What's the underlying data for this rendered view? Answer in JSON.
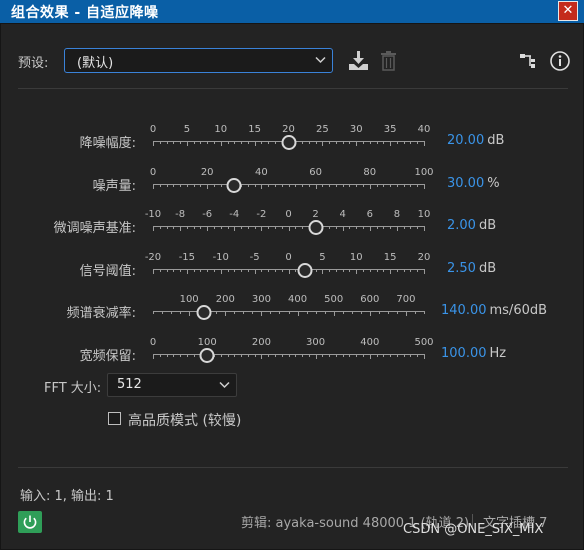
{
  "window": {
    "title": "组合效果 - 自适应降噪",
    "close_symbol": "✕"
  },
  "preset": {
    "label": "预设:",
    "value": "(默认)"
  },
  "icons": {
    "save_preset": "save-preset-icon",
    "delete_preset": "trash-icon",
    "routing": "routing-icon",
    "info": "info-icon"
  },
  "sliders": [
    {
      "label": "降噪幅度:",
      "min": 0,
      "max": 40,
      "ticks": [
        "0",
        "5",
        "10",
        "15",
        "20",
        "25",
        "30",
        "35",
        "40"
      ],
      "value": 20,
      "value_text": "20.00",
      "unit": "dB"
    },
    {
      "label": "噪声量:",
      "min": 0,
      "max": 100,
      "ticks": [
        "0",
        "20",
        "40",
        "60",
        "80",
        "100"
      ],
      "value": 30,
      "value_text": "30.00",
      "unit": "%"
    },
    {
      "label": "微调噪声基准:",
      "min": -10,
      "max": 10,
      "ticks": [
        "-10",
        "-8",
        "-6",
        "-4",
        "-2",
        "0",
        "2",
        "4",
        "6",
        "8",
        "10"
      ],
      "value": 2,
      "value_text": "2.00",
      "unit": "dB"
    },
    {
      "label": "信号阈值:",
      "min": -20,
      "max": 20,
      "ticks": [
        "-20",
        "-15",
        "-10",
        "-5",
        "0",
        "5",
        "10",
        "15",
        "20"
      ],
      "value": 2.5,
      "value_text": "2.50",
      "unit": "dB"
    },
    {
      "label": "频谱衰减率:",
      "min": 0,
      "max": 750,
      "ticks": [
        "100",
        "200",
        "300",
        "400",
        "500",
        "600",
        "700"
      ],
      "value": 140,
      "value_text": "140.00",
      "unit": "ms/60dB"
    },
    {
      "label": "宽频保留:",
      "min": 0,
      "max": 500,
      "ticks": [
        "0",
        "100",
        "200",
        "300",
        "400",
        "500"
      ],
      "value": 100,
      "value_text": "100.00",
      "unit": "Hz"
    }
  ],
  "fft": {
    "label": "FFT 大小:",
    "value": "512"
  },
  "high_quality": {
    "label": "高品质模式 (较慢)",
    "checked": false
  },
  "footer": {
    "io": "输入: 1, 输出: 1",
    "clip": "剪辑: ayaka-sound 48000 1 (轨道 2)",
    "slot": "文字插槽 7",
    "power_on": true
  },
  "watermark": "CSDN @ONE_SIX_MIX",
  "colors": {
    "accent": "#3a94e8",
    "titlebar": "#0a5fa6",
    "close": "#c42b1c",
    "power": "#2f9e58"
  }
}
